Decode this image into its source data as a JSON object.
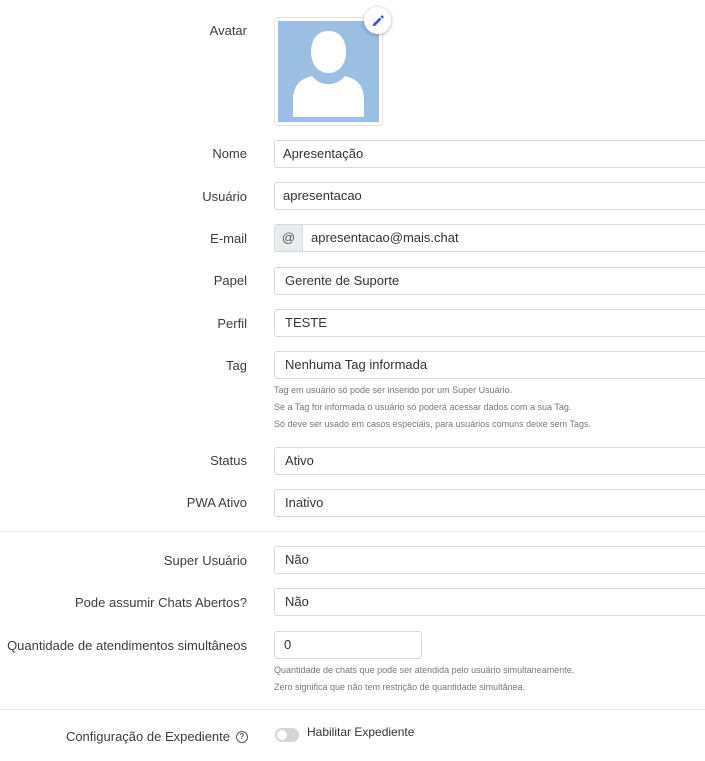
{
  "avatar": {
    "label": "Avatar"
  },
  "nome": {
    "label": "Nome",
    "value": "Apresentação"
  },
  "usuario": {
    "label": "Usuário",
    "value": "apresentacao"
  },
  "email": {
    "label": "E-mail",
    "addon": "@",
    "value": "apresentacao@mais.chat"
  },
  "papel": {
    "label": "Papel",
    "value": "Gerente de Suporte"
  },
  "perfil": {
    "label": "Perfil",
    "value": "TESTE"
  },
  "tag": {
    "label": "Tag",
    "value": "Nenhuma Tag informada",
    "help": [
      "Tag em usuário só pode ser inserido por um Super Usuário.",
      "Se a Tag for informada o usuário só poderá acessar dados com a sua Tag.",
      "Só deve ser usado em casos especiais, para usuários comuns deixe sem Tags."
    ]
  },
  "status": {
    "label": "Status",
    "value": "Ativo"
  },
  "pwa": {
    "label": "PWA Ativo",
    "value": "Inativo"
  },
  "super_usuario": {
    "label": "Super Usuário",
    "value": "Não"
  },
  "chats_abertos": {
    "label": "Pode assumir Chats Abertos?",
    "value": "Não"
  },
  "atendimentos": {
    "label": "Quantidade de atendimentos simultâneos",
    "value": "0",
    "help": [
      "Quantidade de chats que pode ser atendida pelo usuário simultaneamente.",
      "Zero significa que não tem restrição de quantidade simultânea."
    ]
  },
  "expediente": {
    "label": "Configuração de Expediente",
    "help_icon": "question-circle-icon",
    "toggle_label": "Habilitar Expediente",
    "enabled": false
  },
  "colors": {
    "avatar_bg": "#9bbfe3",
    "edit_icon": "#3b5bdb"
  }
}
